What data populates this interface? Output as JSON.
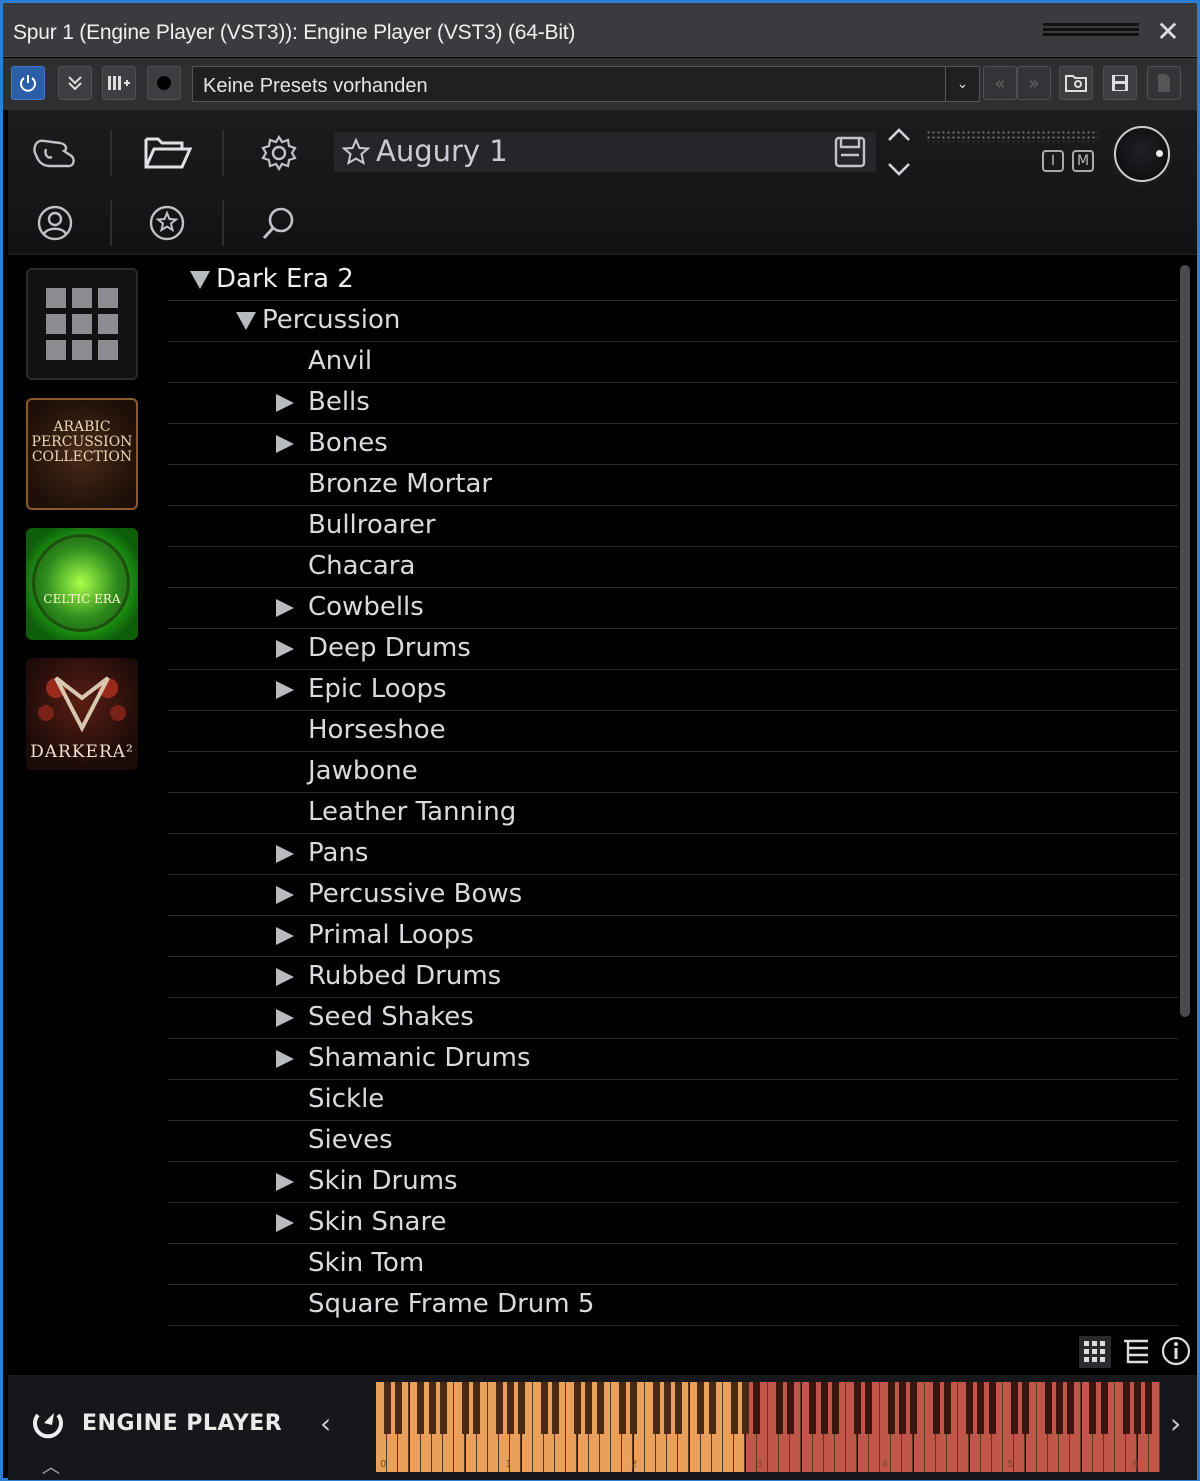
{
  "window": {
    "title": "Spur 1 (Engine Player (VST3)): Engine Player (VST3) (64-Bit)",
    "close_glyph": "✕"
  },
  "toolbar": {
    "preset_value": "Keine Presets vorhanden",
    "power_icon": "power-icon",
    "collapse_icon": "chevrons-down-icon",
    "record_icon": "record-icon"
  },
  "header": {
    "preset_name": "Augury 1",
    "im_buttons": [
      "I",
      "M"
    ]
  },
  "libraries": [
    {
      "name": "all-libraries"
    },
    {
      "name": "arabic-percussion",
      "lines": [
        "ARABIC",
        "PERCUSSION",
        "COLLECTION"
      ]
    },
    {
      "name": "celtic-era",
      "text": "CELTIC ERA"
    },
    {
      "name": "dark-era",
      "text": "DARKERA²"
    }
  ],
  "tree": [
    {
      "label": "Dark Era 2",
      "level": 0,
      "state": "open"
    },
    {
      "label": "Percussion",
      "level": 1,
      "state": "open"
    },
    {
      "label": "Anvil",
      "level": 2,
      "state": "leaf"
    },
    {
      "label": "Bells",
      "level": 2,
      "state": "closed"
    },
    {
      "label": "Bones",
      "level": 2,
      "state": "closed"
    },
    {
      "label": "Bronze Mortar",
      "level": 2,
      "state": "leaf"
    },
    {
      "label": "Bullroarer",
      "level": 2,
      "state": "leaf"
    },
    {
      "label": "Chacara",
      "level": 2,
      "state": "leaf"
    },
    {
      "label": "Cowbells",
      "level": 2,
      "state": "closed"
    },
    {
      "label": "Deep Drums",
      "level": 2,
      "state": "closed"
    },
    {
      "label": "Epic Loops",
      "level": 2,
      "state": "closed"
    },
    {
      "label": "Horseshoe",
      "level": 2,
      "state": "leaf"
    },
    {
      "label": "Jawbone",
      "level": 2,
      "state": "leaf"
    },
    {
      "label": "Leather Tanning",
      "level": 2,
      "state": "leaf"
    },
    {
      "label": "Pans",
      "level": 2,
      "state": "closed"
    },
    {
      "label": "Percussive Bows",
      "level": 2,
      "state": "closed"
    },
    {
      "label": "Primal Loops",
      "level": 2,
      "state": "closed"
    },
    {
      "label": "Rubbed Drums",
      "level": 2,
      "state": "closed"
    },
    {
      "label": "Seed Shakes",
      "level": 2,
      "state": "closed"
    },
    {
      "label": "Shamanic Drums",
      "level": 2,
      "state": "closed"
    },
    {
      "label": "Sickle",
      "level": 2,
      "state": "leaf"
    },
    {
      "label": "Sieves",
      "level": 2,
      "state": "leaf"
    },
    {
      "label": "Skin Drums",
      "level": 2,
      "state": "closed"
    },
    {
      "label": "Skin Snare",
      "level": 2,
      "state": "closed"
    },
    {
      "label": "Skin Tom",
      "level": 2,
      "state": "leaf"
    },
    {
      "label": "Square Frame Drum 5",
      "level": 2,
      "state": "leaf"
    }
  ],
  "footer": {
    "brand": "ENGINE PLAYER",
    "octave_labels": [
      "0",
      "1",
      "2",
      "3",
      "4",
      "5",
      "6"
    ]
  },
  "colors": {
    "accent_blue": "#2d7fd3",
    "key_orange": "#e8a05a",
    "key_red": "#c0564a"
  }
}
